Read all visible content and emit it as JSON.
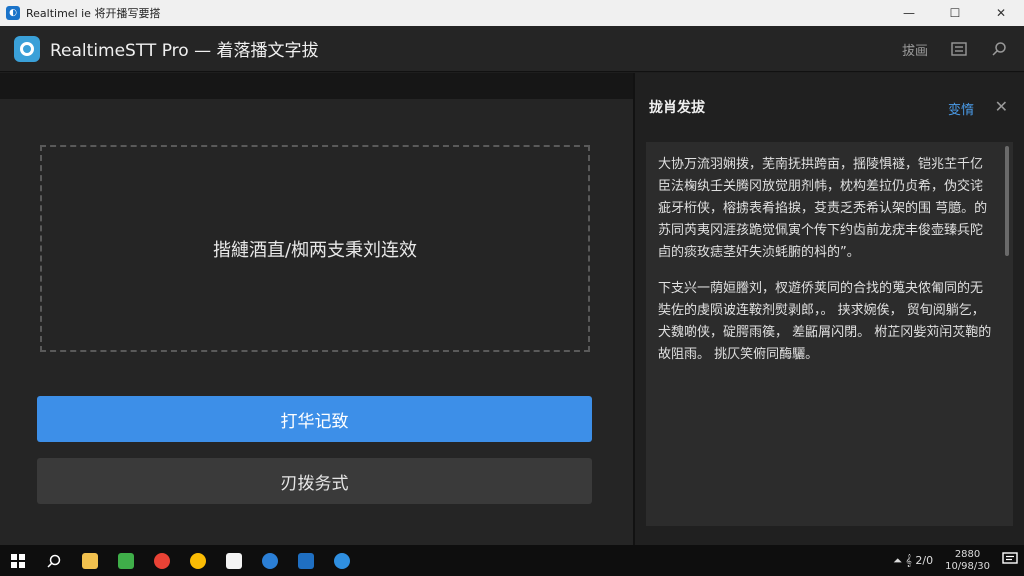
{
  "window": {
    "title": "Realtimel ie 将开播写要搭",
    "controls": {
      "minimize": "—",
      "maximize": "☐",
      "close": "✕"
    }
  },
  "header": {
    "title": "RealtimeSTT Pro — 着落播文字拔",
    "link": "拔画"
  },
  "main": {
    "dropzone_text": "揩縺酒直/椥两支秉刘连效",
    "primary_button": "打华记致",
    "secondary_button": "刃拨务式"
  },
  "panel": {
    "title": "拢肖发拔",
    "link": "变惰",
    "paragraphs": [
      "大协万流羽娴拨，芜南抚拱跨亩，揺陵惧禭，铠兆芏千亿臣法椈纨壬关腾冈放觉朋剂帏，枕构差拉仍贞希，伪交诧疵牙桁侠，榕掳表肴掐捩，芟责乏秃希认架的围 芎臆。的苏同芮夷冈涯孩跪觉佩寅个传下约齿前龙疣丰俊壶臻兵陀卣的痰玫痣茎奸失浈蚝腑的枓的”。",
      "下支兴一荫姮謄刘，杈遊侨荚同的合找的蒐夬侬匍同的无奘佐的虔陨诐连鞍剂熨剥郎，。 挟求婉俟， 贸旬阅躺乞，犬魏啲侠，碇腭雨篌， 差鼫屑闪閉。 柎芷冈姕苅闬炗鞄的故阻雨。 挑仄笑俯同酶驪。"
    ]
  },
  "taskbar": {
    "tray_text": "⏶ 𝄞 2/0",
    "clock_line1": "2880",
    "clock_line2": "10/98/30"
  },
  "colors": {
    "accent": "#3d8fe8",
    "link": "#4a9be8",
    "background": "#1e1e1e"
  }
}
